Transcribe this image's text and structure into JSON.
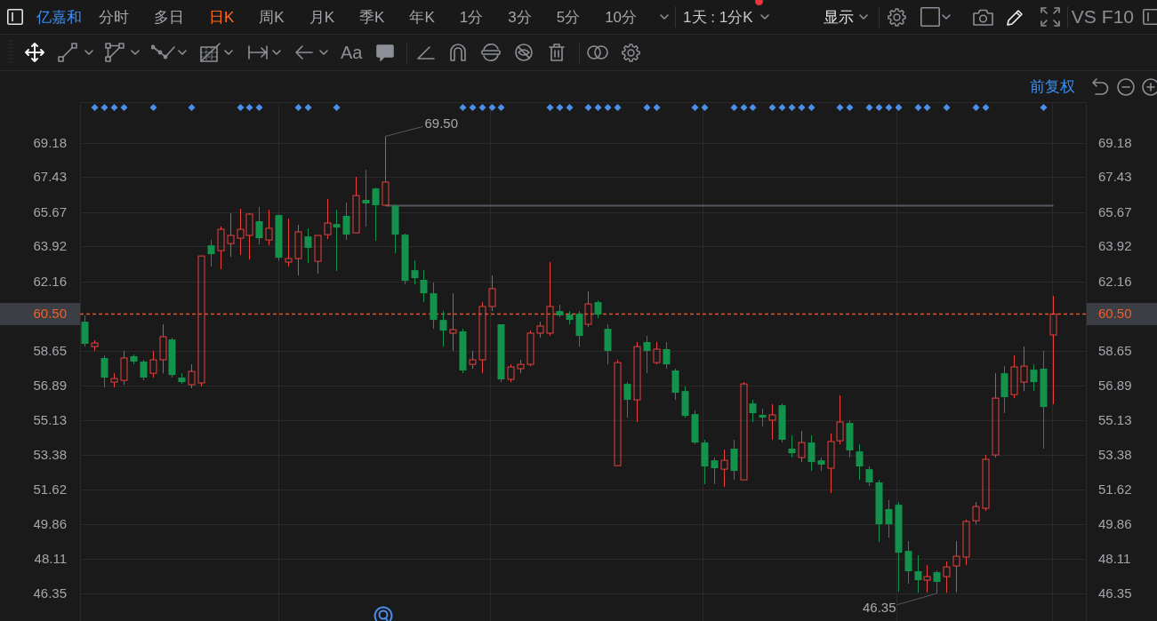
{
  "top_bar": {
    "stock_name": "亿嘉和",
    "periods": [
      {
        "label": "分时",
        "selected": false
      },
      {
        "label": "多日",
        "selected": false
      },
      {
        "label": "日K",
        "selected": true
      },
      {
        "label": "周K",
        "selected": false
      },
      {
        "label": "月K",
        "selected": false
      },
      {
        "label": "季K",
        "selected": false
      },
      {
        "label": "年K",
        "selected": false
      },
      {
        "label": "1分",
        "selected": false
      },
      {
        "label": "3分",
        "selected": false
      },
      {
        "label": "5分",
        "selected": false
      },
      {
        "label": "10分",
        "selected": false
      }
    ],
    "interval_menu": {
      "label": "1天 : 1分K",
      "notification": true
    },
    "display_menu": {
      "label": "显示"
    },
    "buttons": [
      "VS",
      "F10"
    ]
  },
  "drawing_toolbar": {
    "text_tool": "Aa"
  },
  "chart": {
    "adjustment": "前复权",
    "right_axis_labels": [
      "69.18",
      "67.43",
      "65.67",
      "63.92",
      "62.16",
      "58.65",
      "56.89",
      "55.13",
      "53.38",
      "51.62",
      "49.86",
      "48.11",
      "46.35"
    ],
    "right_price_label": "60.50",
    "high_label": "69.50",
    "low_label": "46.35",
    "chart_data": {
      "type": "candlestick",
      "grid": true,
      "ylim": [
        44.95,
        71.23
      ],
      "yticks": [
        69.18,
        67.43,
        65.67,
        63.92,
        62.16,
        58.65,
        56.89,
        55.13,
        53.38,
        51.62,
        49.86,
        48.11,
        46.35
      ],
      "ref_lines": [
        {
          "axis": "y",
          "value": 66.01,
          "color": "#55585e"
        },
        {
          "axis": "y",
          "value": 60.5,
          "color": "#e2562a",
          "label": "60.50"
        }
      ],
      "categories": [
        null,
        null,
        null,
        null,
        null,
        null,
        null,
        null,
        null,
        null,
        null,
        null,
        null,
        null,
        null,
        null,
        null,
        null,
        null,
        null,
        null,
        null,
        null,
        null,
        null,
        null,
        null,
        null,
        null,
        null,
        null,
        null,
        null,
        null,
        null,
        null,
        null,
        null,
        null,
        null,
        null,
        null,
        null,
        null,
        null,
        null,
        null,
        null,
        null,
        null,
        null,
        null,
        null,
        null,
        null,
        null,
        null,
        null,
        null,
        null,
        null,
        null,
        null,
        null,
        null,
        null,
        null,
        null,
        null,
        null,
        null,
        null,
        null,
        null,
        null,
        null,
        null,
        null,
        null,
        null,
        null,
        null,
        null,
        null,
        null,
        null,
        null,
        null,
        null,
        null,
        null,
        null,
        null,
        null,
        null,
        null,
        null,
        null,
        null,
        null,
        null,
        null,
        null,
        null
      ],
      "ohlc": [
        [
          60.11,
          60.43,
          58.85,
          58.99
        ],
        [
          58.85,
          59.17,
          58.63,
          59.03
        ],
        [
          58.27,
          58.4,
          56.78,
          57.28
        ],
        [
          57.05,
          57.5,
          56.78,
          57.23
        ],
        [
          57.14,
          58.63,
          56.92,
          58.27
        ],
        [
          58.36,
          58.45,
          57.95,
          58.09
        ],
        [
          58.09,
          58.18,
          57.14,
          57.28
        ],
        [
          57.5,
          58.63,
          57.28,
          58.18
        ],
        [
          58.18,
          59.98,
          57.5,
          59.35
        ],
        [
          59.21,
          59.3,
          57.28,
          57.41
        ],
        [
          57.28,
          57.5,
          56.96,
          57.05
        ],
        [
          56.92,
          57.95,
          56.74,
          57.59
        ],
        [
          57.01,
          63.44,
          56.83,
          63.44
        ],
        [
          63.98,
          64.25,
          62.9,
          63.53
        ],
        [
          63.71,
          64.93,
          62.77,
          64.79
        ],
        [
          64.07,
          65.6,
          63.4,
          64.48
        ],
        [
          64.34,
          65.83,
          63.49,
          64.79
        ],
        [
          64.48,
          65.6,
          63.26,
          65.56
        ],
        [
          65.2,
          65.92,
          64.03,
          64.34
        ],
        [
          64.25,
          65.78,
          63.98,
          64.84
        ],
        [
          65.51,
          65.56,
          63.22,
          63.35
        ],
        [
          63.13,
          65.33,
          62.9,
          63.31
        ],
        [
          63.31,
          65.02,
          62.45,
          64.66
        ],
        [
          64.43,
          64.84,
          63.08,
          63.85
        ],
        [
          63.17,
          64.48,
          62.54,
          64.48
        ],
        [
          64.52,
          66.32,
          64.3,
          65.11
        ],
        [
          65.06,
          65.78,
          62.68,
          64.88
        ],
        [
          65.47,
          66.14,
          64.25,
          64.52
        ],
        [
          64.61,
          67.45,
          64.61,
          66.5
        ],
        [
          66.28,
          67.81,
          64.93,
          66.1
        ],
        [
          66.86,
          66.91,
          64.21,
          66.01
        ],
        [
          66.01,
          69.5,
          66.01,
          67.18
        ],
        [
          65.96,
          66.05,
          63.58,
          64.52
        ],
        [
          64.52,
          64.57,
          62.0,
          62.18
        ],
        [
          62.72,
          63.22,
          62.0,
          62.32
        ],
        [
          62.23,
          62.72,
          61.1,
          61.55
        ],
        [
          61.55,
          62.09,
          59.75,
          60.2
        ],
        [
          60.2,
          60.65,
          58.85,
          59.66
        ],
        [
          59.53,
          61.55,
          58.63,
          59.71
        ],
        [
          59.62,
          59.75,
          57.5,
          57.64
        ],
        [
          57.95,
          58.63,
          57.73,
          58.18
        ],
        [
          58.18,
          61.1,
          57.5,
          60.88
        ],
        [
          60.88,
          62.45,
          60.65,
          61.78
        ],
        [
          59.98,
          59.98,
          57.05,
          57.19
        ],
        [
          57.19,
          57.95,
          57.05,
          57.82
        ],
        [
          57.73,
          58.18,
          57.5,
          57.95
        ],
        [
          57.95,
          59.66,
          57.86,
          59.53
        ],
        [
          59.53,
          60.11,
          59.3,
          59.89
        ],
        [
          59.53,
          63.13,
          59.39,
          60.88
        ],
        [
          60.65,
          60.97,
          60.34,
          60.43
        ],
        [
          60.47,
          60.65,
          59.98,
          60.2
        ],
        [
          60.52,
          60.65,
          58.85,
          59.39
        ],
        [
          59.98,
          61.64,
          59.84,
          61.01
        ],
        [
          61.1,
          61.19,
          60.29,
          60.47
        ],
        [
          59.75,
          59.98,
          57.95,
          58.63
        ],
        [
          52.82,
          58.18,
          52.82,
          58.04
        ],
        [
          56.96,
          57.05,
          55.25,
          56.15
        ],
        [
          56.15,
          59.08,
          55.03,
          58.85
        ],
        [
          59.08,
          59.39,
          57.5,
          58.63
        ],
        [
          58.04,
          59.08,
          57.95,
          58.72
        ],
        [
          58.72,
          59.08,
          57.73,
          57.95
        ],
        [
          57.64,
          57.73,
          56.15,
          56.51
        ],
        [
          56.6,
          56.83,
          55.25,
          55.34
        ],
        [
          55.43,
          55.61,
          53.9,
          53.99
        ],
        [
          53.99,
          54.13,
          51.88,
          52.78
        ],
        [
          53.09,
          53.23,
          51.88,
          52.69
        ],
        [
          52.64,
          53.63,
          51.74,
          53.09
        ],
        [
          53.68,
          54.13,
          52.1,
          52.55
        ],
        [
          52.1,
          57.05,
          52.1,
          56.96
        ],
        [
          55.97,
          56.15,
          55.03,
          55.48
        ],
        [
          55.39,
          55.7,
          54.8,
          55.25
        ],
        [
          55.12,
          55.93,
          54.13,
          55.39
        ],
        [
          55.88,
          55.97,
          53.99,
          54.13
        ],
        [
          53.68,
          54.35,
          53.23,
          53.45
        ],
        [
          53.23,
          54.58,
          53.0,
          53.99
        ],
        [
          53.99,
          54.35,
          52.55,
          53.0
        ],
        [
          53.09,
          53.23,
          52.55,
          52.87
        ],
        [
          52.69,
          54.44,
          51.43,
          54.04
        ],
        [
          54.08,
          56.38,
          53.9,
          55.03
        ],
        [
          54.98,
          55.12,
          53.23,
          53.59
        ],
        [
          53.54,
          53.9,
          52.1,
          52.78
        ],
        [
          52.64,
          52.78,
          51.79,
          51.97
        ],
        [
          51.97,
          52.1,
          48.95,
          49.85
        ],
        [
          50.62,
          51.07,
          49.18,
          49.85
        ],
        [
          50.84,
          50.98,
          46.43,
          48.41
        ],
        [
          48.5,
          49.0,
          46.84,
          47.47
        ],
        [
          47.47,
          48.28,
          46.38,
          47.02
        ],
        [
          47.02,
          47.78,
          46.4,
          47.2
        ],
        [
          47.42,
          47.51,
          46.35,
          46.93
        ],
        [
          47.2,
          47.96,
          46.38,
          47.69
        ],
        [
          47.74,
          49.0,
          46.4,
          48.23
        ],
        [
          48.19,
          50.08,
          47.78,
          49.99
        ],
        [
          50.03,
          50.98,
          49.85,
          50.75
        ],
        [
          50.66,
          53.36,
          50.53,
          53.14
        ],
        [
          53.36,
          57.5,
          53.23,
          56.24
        ],
        [
          57.5,
          57.86,
          55.48,
          56.29
        ],
        [
          56.42,
          58.4,
          56.24,
          57.82
        ],
        [
          57.05,
          58.85,
          56.6,
          57.86
        ],
        [
          57.68,
          57.95,
          56.6,
          57.05
        ],
        [
          57.73,
          58.63,
          53.68,
          55.79
        ],
        [
          59.44,
          61.42,
          55.93,
          60.5
        ],
        null,
        null,
        null
      ]
    }
  }
}
